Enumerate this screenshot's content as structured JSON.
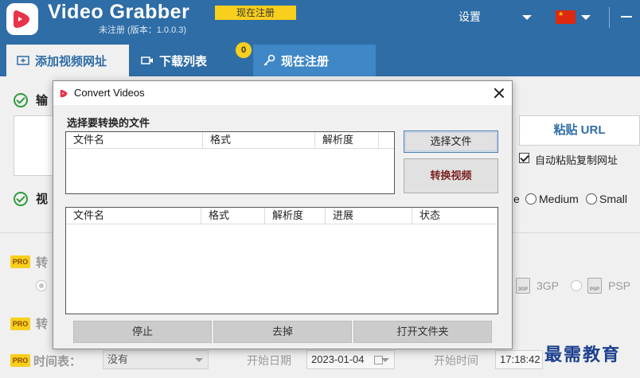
{
  "app": {
    "title": "Video Grabber",
    "version": "未注册 (版本：1.0.0.3)",
    "register_badge": "现在注册",
    "settings_label": "设置"
  },
  "tabs": [
    {
      "label": "添加视频网址"
    },
    {
      "label": "下载列表",
      "badge": "0"
    },
    {
      "label": "现在注册"
    }
  ],
  "background": {
    "section1_label": "输",
    "section2_label": "视",
    "paste_url_label": "粘贴 URL",
    "auto_paste_label": "自动粘贴复制网址",
    "quality_partial": "e",
    "quality_medium": "Medium",
    "quality_small": "Small",
    "pro_badge": "PRO",
    "convert_label": "转",
    "convert_label2": "转",
    "format_3gp": "3GP",
    "format_psp": "PSP",
    "schedule_label": "时间表：",
    "schedule_value": "没有",
    "start_date_label": "开始日期",
    "start_date_value": "2023-01-04",
    "start_time_label": "开始时间",
    "start_time_value": "17:18:42",
    "watermark": "最需教育"
  },
  "dialog": {
    "title": "Convert Videos",
    "section_title": "选择要转换的文件",
    "top_columns": [
      "文件名",
      "格式",
      "解析度"
    ],
    "select_file_label": "选择文件",
    "convert_label": "转换视频",
    "bottom_columns": [
      "文件名",
      "格式",
      "解析度",
      "进展",
      "状态"
    ],
    "stop_label": "停止",
    "remove_label": "去掉",
    "open_folder_label": "打开文件夹"
  },
  "colors": {
    "header_bg": "#2f6da6",
    "accent_yellow": "#f8cf1c",
    "logo_red": "#e8334a",
    "check_green": "#2e9b3e"
  }
}
